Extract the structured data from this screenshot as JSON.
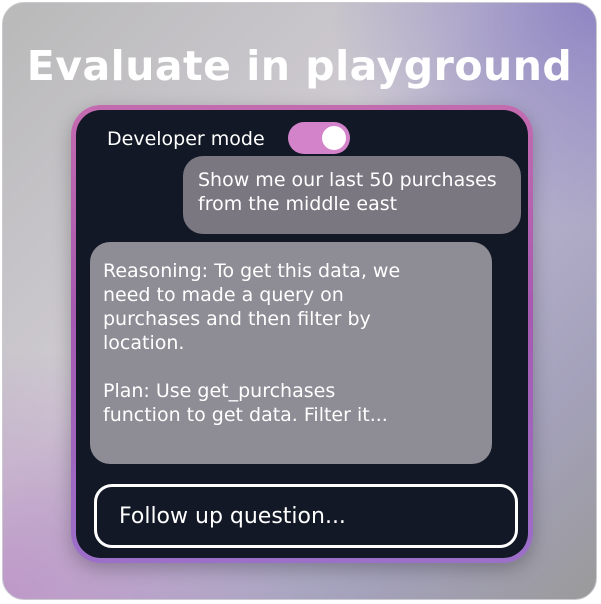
{
  "header": {
    "title": "Evaluate in playground"
  },
  "developer_mode": {
    "label": "Developer mode",
    "enabled": true,
    "toggle_color": "#d383c9"
  },
  "chat": {
    "user_message": {
      "line1": "Show me our last 50 purchases",
      "line2": "from the middle east"
    },
    "assistant_message": {
      "reasoning_lines": [
        "Reasoning: To get this data, we",
        "need to made a query on",
        "purchases and then filter by",
        "location."
      ],
      "plan_lines": [
        "Plan: Use get_purchases",
        "function to get data. Filter it..."
      ]
    }
  },
  "input": {
    "placeholder": "Follow up question..."
  },
  "colors": {
    "screen_background": "#121826",
    "frame_accent": "#c46bb0",
    "user_bubble": "#7a7780",
    "assistant_bubble": "#8e8c94"
  }
}
